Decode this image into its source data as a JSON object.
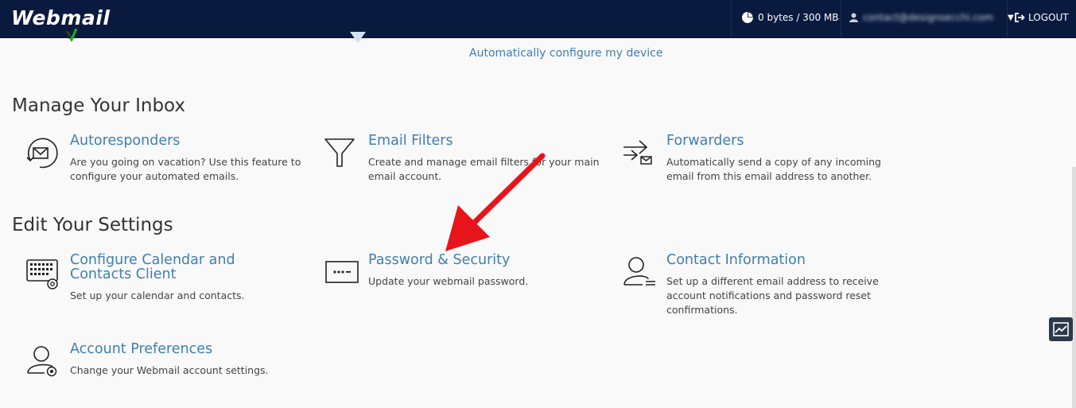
{
  "header": {
    "logo": "Webmail",
    "disk_usage": "0 bytes / 300 MB",
    "user_email": "contact@designsecchi.com",
    "logout": "LOGOUT"
  },
  "top_link": "Automatically configure my device",
  "sections": [
    {
      "title": "Manage Your Inbox",
      "items": [
        {
          "title": "Autoresponders",
          "desc": "Are you going on vacation? Use this feature to configure your automated emails.",
          "icon": "autoresponder-icon"
        },
        {
          "title": "Email Filters",
          "desc": "Create and manage email filters for your main email account.",
          "icon": "filter-icon"
        },
        {
          "title": "Forwarders",
          "desc": "Automatically send a copy of any incoming email from this email address to another.",
          "icon": "forwarder-icon"
        }
      ]
    },
    {
      "title": "Edit Your Settings",
      "items": [
        {
          "title": "Configure Calendar and Contacts Client",
          "desc": "Set up your calendar and contacts.",
          "icon": "calendar-icon"
        },
        {
          "title": "Password & Security",
          "desc": "Update your webmail password.",
          "icon": "password-icon"
        },
        {
          "title": "Contact Information",
          "desc": "Set up a different email address to receive account notifications and password reset confirmations.",
          "icon": "contact-icon"
        },
        {
          "title": "Account Preferences",
          "desc": "Change your Webmail account settings.",
          "icon": "account-preferences-icon"
        }
      ]
    }
  ],
  "colors": {
    "topbar": "#0a1a3f",
    "link": "#3f7fb1",
    "annotation_arrow": "#e8141b"
  }
}
